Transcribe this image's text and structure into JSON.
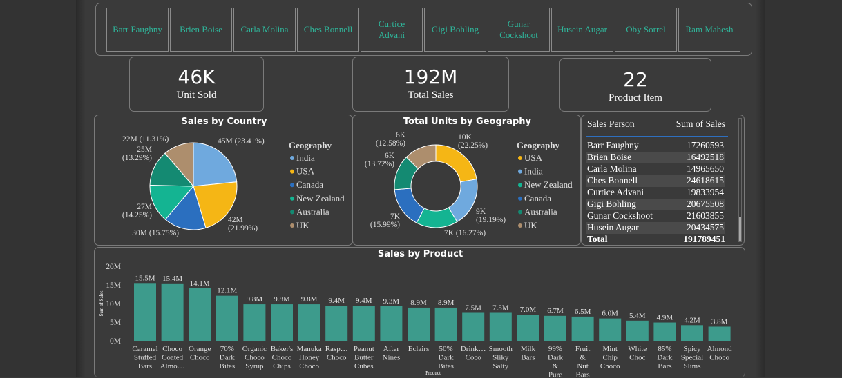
{
  "slicer": {
    "people": [
      "Barr Faughny",
      "Brien Boise",
      "Carla Molina",
      "Ches Bonnell",
      "Curtice Advani",
      "Gigi Bohling",
      "Gunar Cockshoot",
      "Husein Augar",
      "Oby Sorrel",
      "Ram Mahesh"
    ]
  },
  "kpis": {
    "units": {
      "value": "46K",
      "label": "Unit Sold"
    },
    "sales": {
      "value": "192M",
      "label": "Total Sales"
    },
    "items": {
      "value": "22",
      "label": "Product Item"
    }
  },
  "colors": {
    "accent": "#2fb59a",
    "bar": "#3d9b8c"
  },
  "sales_by_country": {
    "title": "Sales by Country",
    "legend_title": "Geography",
    "chart_data": {
      "type": "pie",
      "slices": [
        {
          "name": "India",
          "label": "45M (23.41%)",
          "value": 23.41,
          "color": "#6fa9de"
        },
        {
          "name": "USA",
          "label": "42M (21.99%)",
          "value": 21.99,
          "color": "#f5b615"
        },
        {
          "name": "Canada",
          "label": "30M (15.75%)",
          "value": 15.75,
          "color": "#2b6fbf"
        },
        {
          "name": "New Zealand",
          "label": "27M (14.25%)",
          "value": 14.25,
          "color": "#14b492"
        },
        {
          "name": "Australia",
          "label": "25M (13.29%)",
          "value": 13.29,
          "color": "#148a72"
        },
        {
          "name": "UK",
          "label": "22M (11.31%)",
          "value": 11.31,
          "color": "#ad8e6d"
        }
      ]
    }
  },
  "units_by_geo": {
    "title": "Total Units by Geography",
    "legend_title": "Geography",
    "chart_data": {
      "type": "pie",
      "donut": true,
      "slices": [
        {
          "name": "USA",
          "label": "10K (22.25%)",
          "value": 22.25,
          "color": "#f5b615"
        },
        {
          "name": "India",
          "label": "9K (19.19%)",
          "value": 19.19,
          "color": "#6fa9de"
        },
        {
          "name": "New Zealand",
          "label": "7K (16.27%)",
          "value": 16.27,
          "color": "#14b492"
        },
        {
          "name": "Canada",
          "label": "7K (15.99%)",
          "value": 15.99,
          "color": "#2b6fbf"
        },
        {
          "name": "Australia",
          "label": "6K (13.72%)",
          "value": 13.72,
          "color": "#148a72"
        },
        {
          "name": "UK",
          "label": "6K (12.58%)",
          "value": 12.58,
          "color": "#ad8e6d"
        }
      ]
    }
  },
  "table": {
    "headers": [
      "Sales Person",
      "Sum of Sales"
    ],
    "rows": [
      [
        "Barr Faughny",
        "17260593"
      ],
      [
        "Brien Boise",
        "16492518"
      ],
      [
        "Carla Molina",
        "14965650"
      ],
      [
        "Ches Bonnell",
        "24618615"
      ],
      [
        "Curtice Advani",
        "19833954"
      ],
      [
        "Gigi Bohling",
        "20675508"
      ],
      [
        "Gunar Cockshoot",
        "21603855"
      ],
      [
        "Husein Augar",
        "20434575"
      ]
    ],
    "total": [
      "Total",
      "191789451"
    ]
  },
  "sales_by_product": {
    "title": "Sales by Product",
    "chart_data": {
      "type": "bar",
      "xlabel": "Product",
      "ylabel": "Sum of Sales",
      "yticks": [
        "0M",
        "5M",
        "10M",
        "15M",
        "20M"
      ],
      "ylim": [
        0,
        20
      ],
      "categories": [
        "Caramel Stuffed Bars",
        "Choco Coated Almo…",
        "Orange Choco",
        "70% Dark Bites",
        "Organic Choco Syrup",
        "Baker's Choco Chips",
        "Manuka Honey Choco",
        "Rasp… Choco",
        "Peanut Butter Cubes",
        "After Nines",
        "Eclairs",
        "50% Dark Bites",
        "Drink… Coco",
        "Smooth Sliky Salty",
        "Milk Bars",
        "99% Dark & Pure",
        "Fruit & Nut Bars",
        "Mint Chip Choco",
        "White Choc",
        "85% Dark Bars",
        "Spicy Special Slims",
        "Almond Choco"
      ],
      "values": [
        15.5,
        15.4,
        14.1,
        12.1,
        9.8,
        9.8,
        9.8,
        9.4,
        9.4,
        9.3,
        8.9,
        8.9,
        7.5,
        7.5,
        7.0,
        6.7,
        6.5,
        6.0,
        5.4,
        4.9,
        4.2,
        3.8
      ],
      "data_labels": [
        "15.5M",
        "15.4M",
        "14.1M",
        "12.1M",
        "9.8M",
        "9.8M",
        "9.8M",
        "9.4M",
        "9.4M",
        "9.3M",
        "8.9M",
        "8.9M",
        "7.5M",
        "7.5M",
        "7.0M",
        "6.7M",
        "6.5M",
        "6.0M",
        "5.4M",
        "4.9M",
        "4.2M",
        "3.8M"
      ]
    }
  }
}
